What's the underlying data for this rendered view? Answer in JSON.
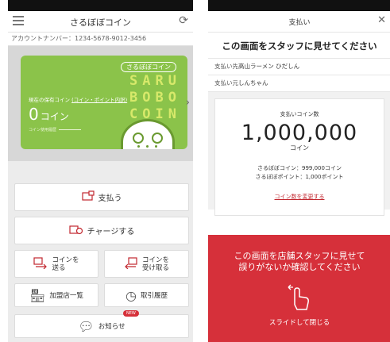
{
  "left": {
    "header": {
      "title": "さるぼぼコイン"
    },
    "account": "アカウントナンバー：1234-5678-9012-3456",
    "card": {
      "brand": "さるぼぼコイン",
      "big_lines": [
        "SARU",
        "BOBO",
        "COIN"
      ],
      "balance_label": "現在の保有コイン",
      "balance_link": "(コイン・ポイント内訳)",
      "balance_value": "0",
      "balance_unit": "コイン",
      "history_label": "コイン使用履歴"
    },
    "buttons": {
      "pay": "支払う",
      "charge": "チャージする",
      "send_line1": "コインを",
      "send_line2": "送る",
      "receive_line1": "コインを",
      "receive_line2": "受け取る",
      "stores": "加盟店一覧",
      "history": "取引履歴",
      "news": "お知らせ",
      "news_badge": "NEW"
    }
  },
  "right": {
    "header": {
      "title": "支払い"
    },
    "headline": "この画面をスタッフに見せてください",
    "payee_label": "支払い先",
    "payee_value": "高山ラーメン ひだしん",
    "payer_label": "支払い元",
    "payer_value": "しんちゃん",
    "amount_caption": "支払いコイン数",
    "amount": "1,000,000",
    "amount_unit": "コイン",
    "balance_coin": "さるぼぼコイン：999,000コイン",
    "balance_point": "さるぼぼポイント：1,000ポイント",
    "change_link": "コイン数を変更する",
    "confirm_line1": "この画面を店舗スタッフに見せて",
    "confirm_line2": "誤りがないか確認してください",
    "slide_text": "スライドして閉じる"
  },
  "colors": {
    "accent_red": "#d6303a",
    "card_green": "#8bc34a",
    "card_text": "#d7e96a"
  }
}
